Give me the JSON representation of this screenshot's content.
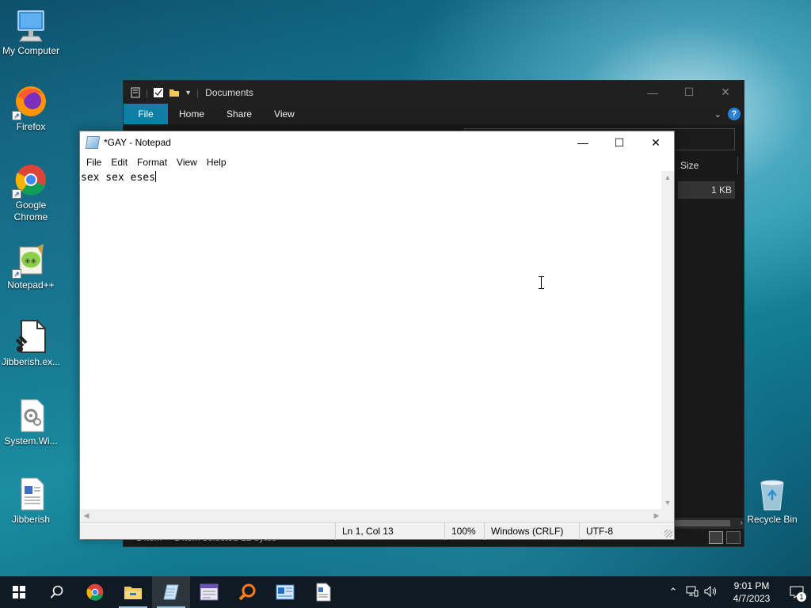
{
  "desktop": {
    "icons": [
      {
        "label": "My Computer",
        "icon": "computer-icon"
      },
      {
        "label": "Firefox",
        "icon": "firefox-icon"
      },
      {
        "label": "Google Chrome",
        "icon": "chrome-icon"
      },
      {
        "label": "Notepad++",
        "icon": "notepadpp-icon"
      },
      {
        "label": "Jibberish.ex...",
        "icon": "exe-file-icon"
      },
      {
        "label": "System.Wi...",
        "icon": "settings-file-icon"
      },
      {
        "label": "Jibberish",
        "icon": "text-document-icon"
      },
      {
        "label": "Recycle Bin",
        "icon": "recycle-bin-icon"
      }
    ]
  },
  "explorer": {
    "title": "Documents",
    "ribbon_tabs": [
      "File",
      "Home",
      "Share",
      "View"
    ],
    "columns": {
      "size": "Size"
    },
    "row_size": "1 KB",
    "status": {
      "items": "1 item",
      "selected": "1 item selected  12 bytes"
    }
  },
  "notepad": {
    "title": "*GAY - Notepad",
    "menu": [
      "File",
      "Edit",
      "Format",
      "View",
      "Help"
    ],
    "content": "sex sex eses",
    "status": {
      "position": "Ln 1, Col 13",
      "zoom": "100%",
      "line_endings": "Windows (CRLF)",
      "encoding": "UTF-8"
    }
  },
  "taskbar": {
    "apps": [
      "chrome-icon",
      "file-explorer-icon",
      "notepad-icon",
      "text-editor-icon",
      "search-tool-icon",
      "outlook-icon",
      "document-icon"
    ],
    "clock": {
      "time": "9:01 PM",
      "date": "4/7/2023"
    },
    "notification_count": "1"
  },
  "colors": {
    "accent": "#0f7fa8",
    "taskbar": "#0f1a22",
    "explorer_bg": "#191919"
  }
}
